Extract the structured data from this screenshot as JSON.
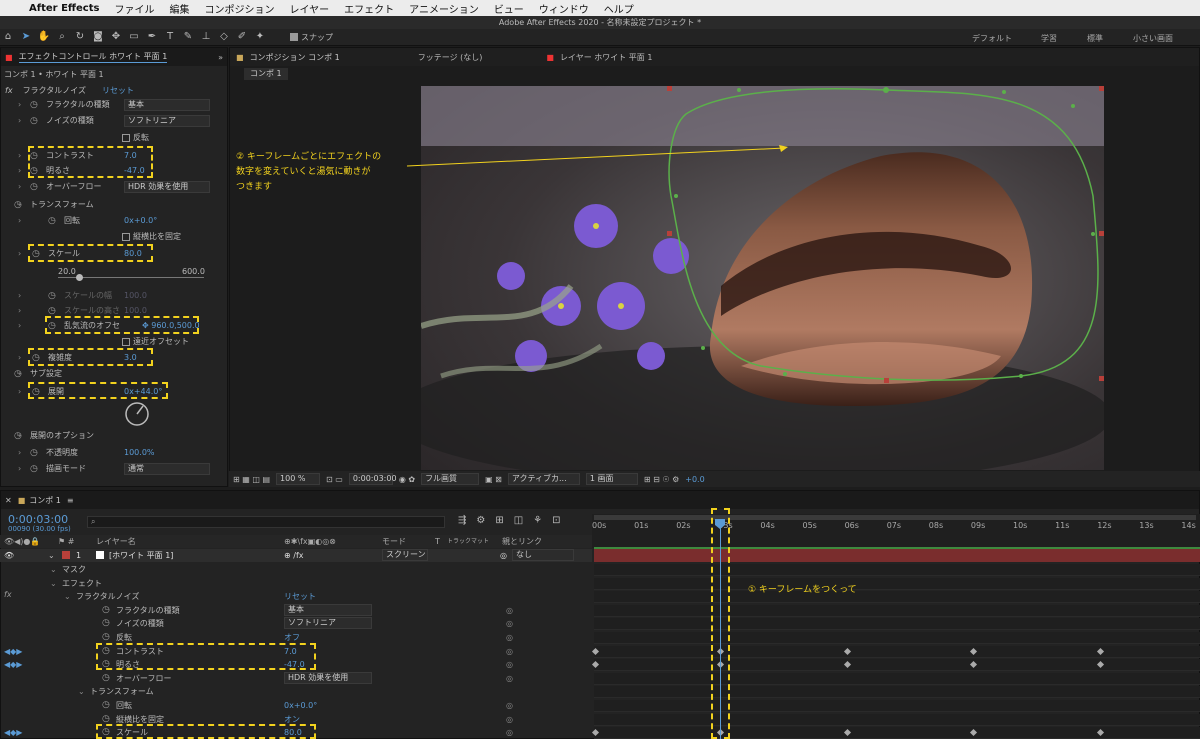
{
  "menu": {
    "apple": "",
    "app": "After Effects",
    "items": [
      "ファイル",
      "編集",
      "コンポジション",
      "レイヤー",
      "エフェクト",
      "アニメーション",
      "ビュー",
      "ウィンドウ",
      "ヘルプ"
    ]
  },
  "title": "Adobe After Effects 2020 - 名称未設定プロジェクト *",
  "toolbar": {
    "snap": "スナップ",
    "workspaces": [
      "デフォルト",
      "学習",
      "標準",
      "小さい画面"
    ]
  },
  "effect_panel": {
    "tab": "エフェクトコントロール ホワイト 平面 1",
    "sub": "コンポ 1 • ホワイト 平面 1",
    "fx": "フラクタルノイズ",
    "reset": "リセット",
    "rows": [
      {
        "label": "フラクタルの種類",
        "drop": "基本"
      },
      {
        "label": "ノイズの種類",
        "drop": "ソフトリニア"
      },
      {
        "label": "",
        "check": "反転"
      },
      {
        "label": "コントラスト",
        "value": "7.0"
      },
      {
        "label": "明るさ",
        "value": "-47.0"
      },
      {
        "label": "オーバーフロー",
        "drop": "HDR 効果を使用"
      },
      {
        "label": "トランスフォーム"
      },
      {
        "label": "回転",
        "value": "0x+0.0°"
      },
      {
        "label": "",
        "check": "縦横比を固定"
      },
      {
        "label": "スケール",
        "value": "80.0"
      },
      {
        "min": "20.0",
        "max": "600.0"
      },
      {
        "label": "スケールの幅",
        "value": "100.0"
      },
      {
        "label": "スケールの高さ",
        "value": "100.0"
      },
      {
        "label": "乱気流のオフセ",
        "value": "960.0,500.0"
      },
      {
        "label": "",
        "check": "遠近オフセット"
      },
      {
        "label": "複雑度",
        "value": "3.0"
      },
      {
        "label": "サブ設定"
      },
      {
        "label": "展開",
        "value": "0x+44.0°"
      },
      {
        "label": "展開のオプション"
      },
      {
        "label": "不透明度",
        "value": "100.0%"
      },
      {
        "label": "描画モード",
        "drop": "通常"
      }
    ]
  },
  "comp_panel": {
    "tab": "コンポジション コンポ 1",
    "footage": "フッテージ (なし)",
    "layer": "レイヤー ホワイト 平面 1",
    "breadcrumb": "コンポ 1",
    "annotation2": "② キーフレームごとにエフェクトの\n数字を変えていくと湯気に動きが\nつきます",
    "bottom": {
      "zoom": "100 %",
      "time": "0:00:03:00",
      "quality": "フル画質",
      "camera": "アクティブカ...",
      "views": "1 画面",
      "exposure": "+0.0"
    }
  },
  "timeline": {
    "tab": "コンポ 1",
    "time": "0:00:03:00",
    "frames": "00090 (30.00 fps)",
    "search_placeholder": "",
    "headers": {
      "layer_name": "レイヤー名",
      "mode": "モード",
      "t": "T",
      "trackmatte": "トラックマット",
      "parent": "親とリンク"
    },
    "layer": {
      "num": "1",
      "name": "[ホワイト 平面 1]",
      "mode": "スクリーン",
      "parent": "なし"
    },
    "ruler": [
      "00s",
      "01s",
      "02s",
      "03s",
      "04s",
      "05s",
      "06s",
      "07s",
      "08s",
      "09s",
      "10s",
      "11s",
      "12s",
      "13s",
      "14s"
    ],
    "annotation1": "① キーフレームをつくって",
    "rows": [
      {
        "label": "マスク",
        "indent": 62
      },
      {
        "label": "エフェクト",
        "indent": 62
      },
      {
        "label": "フラクタルノイズ",
        "indent": 76,
        "right": "リセット"
      },
      {
        "label": "フラクタルの種類",
        "indent": 102,
        "drop": "基本"
      },
      {
        "label": "ノイズの種類",
        "indent": 102,
        "drop": "ソフトリニア"
      },
      {
        "label": "反転",
        "indent": 102,
        "value": "オフ"
      },
      {
        "label": "コントラスト",
        "indent": 102,
        "value": "7.0"
      },
      {
        "label": "明るさ",
        "indent": 102,
        "value": "-47.0"
      },
      {
        "label": "オーバーフロー",
        "indent": 102,
        "drop": "HDR 効果を使用"
      },
      {
        "label": "トランスフォーム",
        "indent": 90
      },
      {
        "label": "回転",
        "indent": 102,
        "value": "0x+0.0°"
      },
      {
        "label": "縦横比を固定",
        "indent": 102,
        "value": "オン"
      },
      {
        "label": "スケール",
        "indent": 102,
        "value": "80.0"
      }
    ]
  }
}
